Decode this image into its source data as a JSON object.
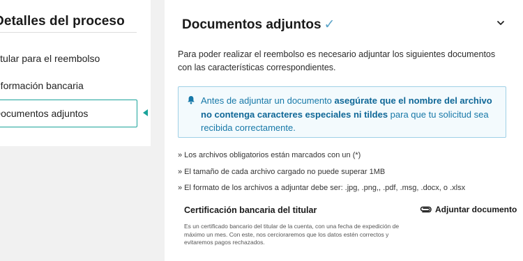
{
  "steps": {
    "title": "Detalles del proceso",
    "items": [
      {
        "label": "Titular para el reembolso"
      },
      {
        "label": "Información bancaria"
      },
      {
        "label": "Documentos adjuntos"
      }
    ]
  },
  "main": {
    "title": "Documentos adjuntos",
    "check_glyph": "✓",
    "intro": "Para poder realizar el reembolso es necesario adjuntar los siguientes documentos con las características correspondientes.",
    "notice": {
      "before": "Antes de adjuntar un documento ",
      "bold": "asegúrate que el nombre del archivo no contenga caracteres especiales ni tildes",
      "after": " para que tu solicitud sea recibida correctamente."
    },
    "rules": [
      "» Los archivos obligatorios están marcados con un (*)",
      "» El tamaño de cada archivo cargado no puede superar 1MB",
      "» El formato de los archivos a adjuntar debe ser: .jpg, .png,, .pdf, .msg, .docx, o .xlsx"
    ],
    "document": {
      "title": "Certificación bancaria del titular",
      "attach_label": "Adjuntar documento",
      "description": "Es un certificado bancario del titular de la cuenta, con una fecha de expedición de máximo un mes. Con este, nos cercioraremos que los datos estén correctos y evitaremos pagos rechazados."
    }
  },
  "colors": {
    "accent": "#1aa39a",
    "notice_border": "#9fd0e6",
    "notice_text": "#1678a8"
  }
}
